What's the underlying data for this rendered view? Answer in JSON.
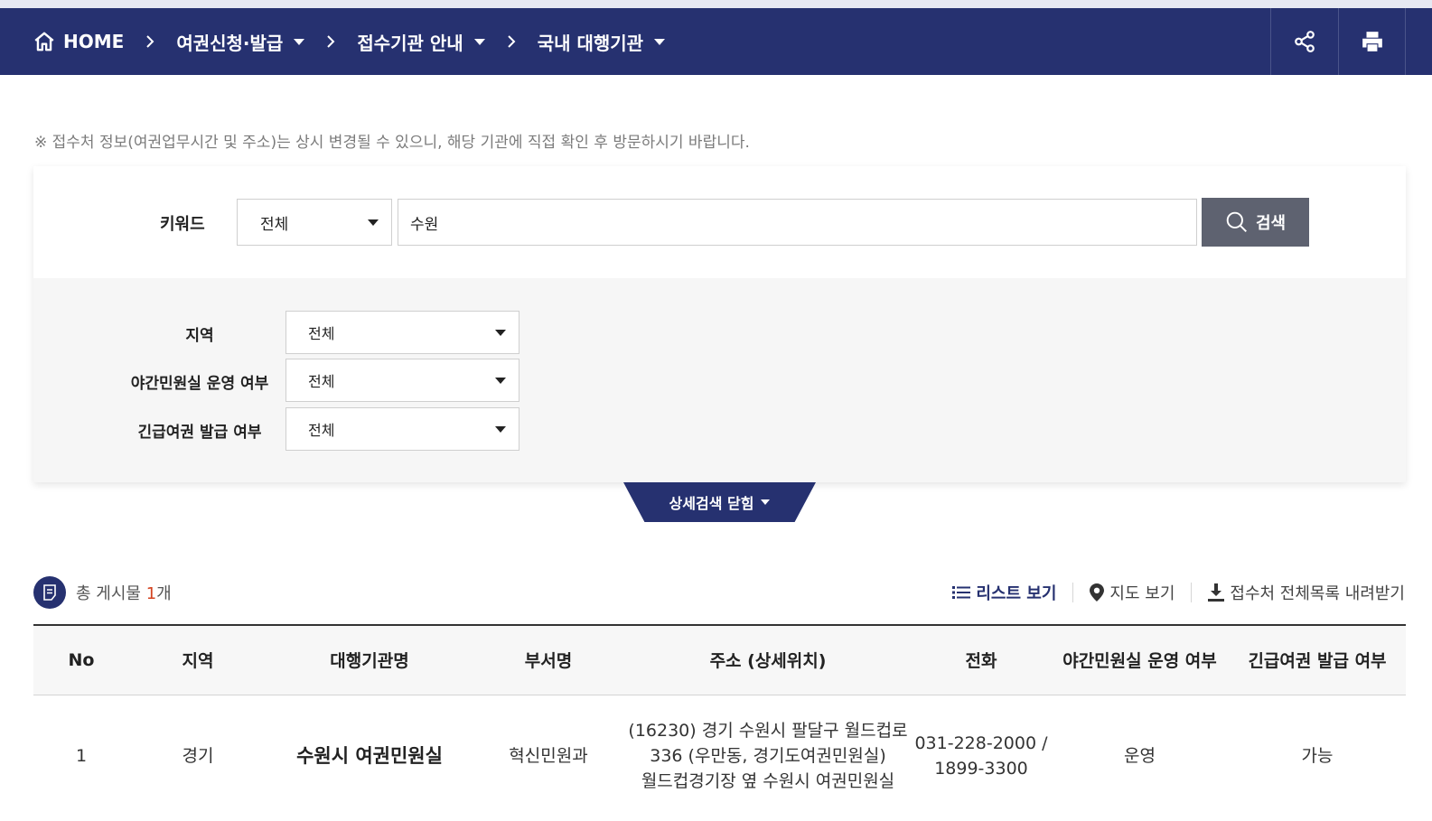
{
  "breadcrumb": {
    "home": "HOME",
    "items": [
      "여권신청·발급",
      "접수기관 안내",
      "국내 대행기관"
    ]
  },
  "notice": "※ 접수처 정보(여권업무시간 및 주소)는 상시 변경될 수 있으니, 해당 기관에 직접 확인 후 방문하시기 바랍니다.",
  "search": {
    "keyword_label": "키워드",
    "scope_selected": "전체",
    "keyword_value": "수원",
    "button": "검색"
  },
  "filters": [
    {
      "label": "지역",
      "selected": "전체"
    },
    {
      "label": "야간민원실 운영 여부",
      "selected": "전체"
    },
    {
      "label": "긴급여권 발급 여부",
      "selected": "전체"
    }
  ],
  "toggle_label": "상세검색 닫힘",
  "count": {
    "prefix": "총 게시물 ",
    "number": "1",
    "suffix": "개"
  },
  "views": {
    "list": "리스트 보기",
    "map": "지도 보기",
    "download": "접수처 전체목록 내려받기"
  },
  "table": {
    "headers": [
      "No",
      "지역",
      "대행기관명",
      "부서명",
      "주소 (상세위치)",
      "전화",
      "야간민원실 운영 여부",
      "긴급여권 발급 여부"
    ],
    "rows": [
      {
        "no": "1",
        "region": "경기",
        "name": "수원시 여권민원실",
        "dept": "혁신민원과",
        "address": [
          "(16230) 경기 수원시 팔달구 월드컵로",
          "336 (우만동, 경기도여권민원실)",
          "월드컵경기장 옆 수원시 여권민원실"
        ],
        "phone": [
          "031-228-2000 /",
          "1899-3300"
        ],
        "night": "운영",
        "urgent": "가능"
      }
    ]
  },
  "colors": {
    "navy": "#263170",
    "button_gray": "#5e6270",
    "accent_red": "#d3421f"
  }
}
